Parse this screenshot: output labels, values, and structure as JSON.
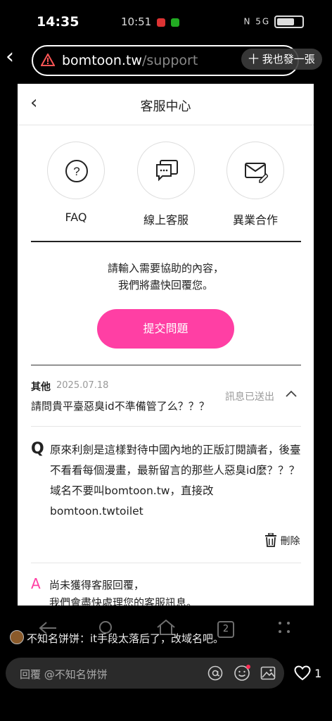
{
  "status_bar": {
    "time": "14:35",
    "other_time": "10:51",
    "right_icons": "N 5G"
  },
  "browser": {
    "domain": "bomtoon.tw",
    "path": "/support",
    "repost_label": "十 我也發一張"
  },
  "page": {
    "title": "客服中心",
    "menu": [
      {
        "label": "FAQ",
        "icon": "question-icon"
      },
      {
        "label": "線上客服",
        "icon": "chat-icon"
      },
      {
        "label": "異業合作",
        "icon": "mail-edit-icon"
      }
    ],
    "help_line1": "請輸入需要協助的內容，",
    "help_line2": "我們將盡快回覆您。",
    "submit_label": "提交問題",
    "inquiry": {
      "category": "其他",
      "date": "2025.07.18",
      "title": "請問貴平臺惡臭id不準備管了么？？？",
      "status": "訊息已送出",
      "q_mark": "Q",
      "question": "原來利劍是這樣對待中國內地的正版訂閱讀者，後臺不看看每個漫畫，最新留言的那些人惡臭id麼？？？域名不要叫bomtoon.tw，直接改bomtoon.twtoilet",
      "delete_label": "刪除",
      "a_mark": "A",
      "answer_line1": "尚未獲得客服回覆，",
      "answer_line2": "我們會盡快處理您的客服訊息。"
    }
  },
  "nav": {
    "tab_count": "2"
  },
  "comment": {
    "author_text": "不知名饼饼：it手段太落后了，改域名吧。",
    "reply_placeholder": "回覆 @不知名饼饼",
    "like_count": "1"
  },
  "colors": {
    "accent": "#ff3fa4",
    "background": "#000000"
  }
}
